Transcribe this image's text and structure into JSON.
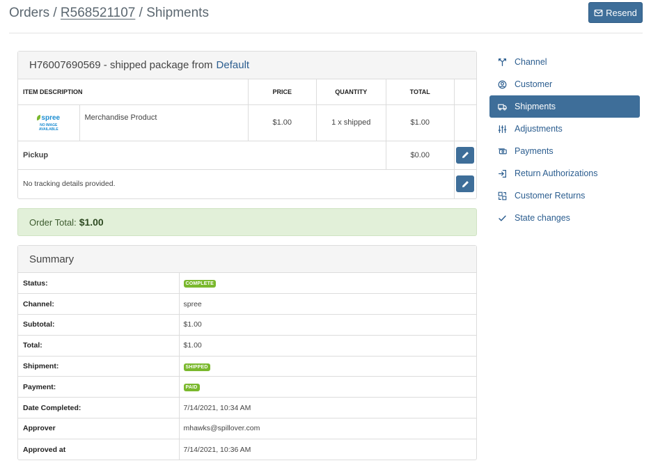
{
  "breadcrumb": {
    "orders": "Orders",
    "sep1": " / ",
    "order_number": "R568521107",
    "sep2": " / ",
    "current": "Shipments"
  },
  "actions": {
    "resend_label": "Resend"
  },
  "shipment": {
    "number": "H76007690569",
    "description": "- shipped package from",
    "location": "Default",
    "columns": {
      "item_description": "Item Description",
      "price": "Price",
      "quantity": "Quantity",
      "total": "Total"
    },
    "items": [
      {
        "image_brand": "spree",
        "image_text_1": "NO IMAGE",
        "image_text_2": "AVAILABLE",
        "name": "Merchandise Product",
        "price": "$1.00",
        "quantity": "1 x shipped",
        "total": "$1.00"
      }
    ],
    "method": {
      "name": "Pickup",
      "cost": "$0.00"
    },
    "tracking": "No tracking details provided."
  },
  "order_total": {
    "label": "Order Total:",
    "value": "$1.00"
  },
  "summary": {
    "title": "Summary",
    "rows": {
      "status": {
        "label": "Status:",
        "value": "COMPLETE"
      },
      "channel": {
        "label": "Channel:",
        "value": "spree"
      },
      "subtotal": {
        "label": "Subtotal:",
        "value": "$1.00"
      },
      "total": {
        "label": "Total:",
        "value": "$1.00"
      },
      "shipment": {
        "label": "Shipment:",
        "value": "SHIPPED"
      },
      "payment": {
        "label": "Payment:",
        "value": "PAID"
      },
      "date_completed": {
        "label": "Date Completed:",
        "value": "7/14/2021, 10:34 AM"
      },
      "approver": {
        "label": "Approver",
        "value": "mhawks@spillover.com"
      },
      "approved_at": {
        "label": "Approved at",
        "value": "7/14/2021, 10:36 AM"
      }
    }
  },
  "sidebar": {
    "items": [
      {
        "label": "Channel",
        "icon": "channel-icon",
        "active": false
      },
      {
        "label": "Customer",
        "icon": "user-circle-icon",
        "active": false
      },
      {
        "label": "Shipments",
        "icon": "truck-icon",
        "active": true
      },
      {
        "label": "Adjustments",
        "icon": "sliders-icon",
        "active": false
      },
      {
        "label": "Payments",
        "icon": "cash-icon",
        "active": false
      },
      {
        "label": "Return Authorizations",
        "icon": "login-arrow-icon",
        "active": false
      },
      {
        "label": "Customer Returns",
        "icon": "return-boxes-icon",
        "active": false
      },
      {
        "label": "State changes",
        "icon": "check-icon",
        "active": false
      }
    ]
  },
  "colors": {
    "primary": "#3e6e99",
    "link": "#2b5d8f",
    "success_bg": "#e2f0d9",
    "badge_green": "#7ab82d"
  }
}
